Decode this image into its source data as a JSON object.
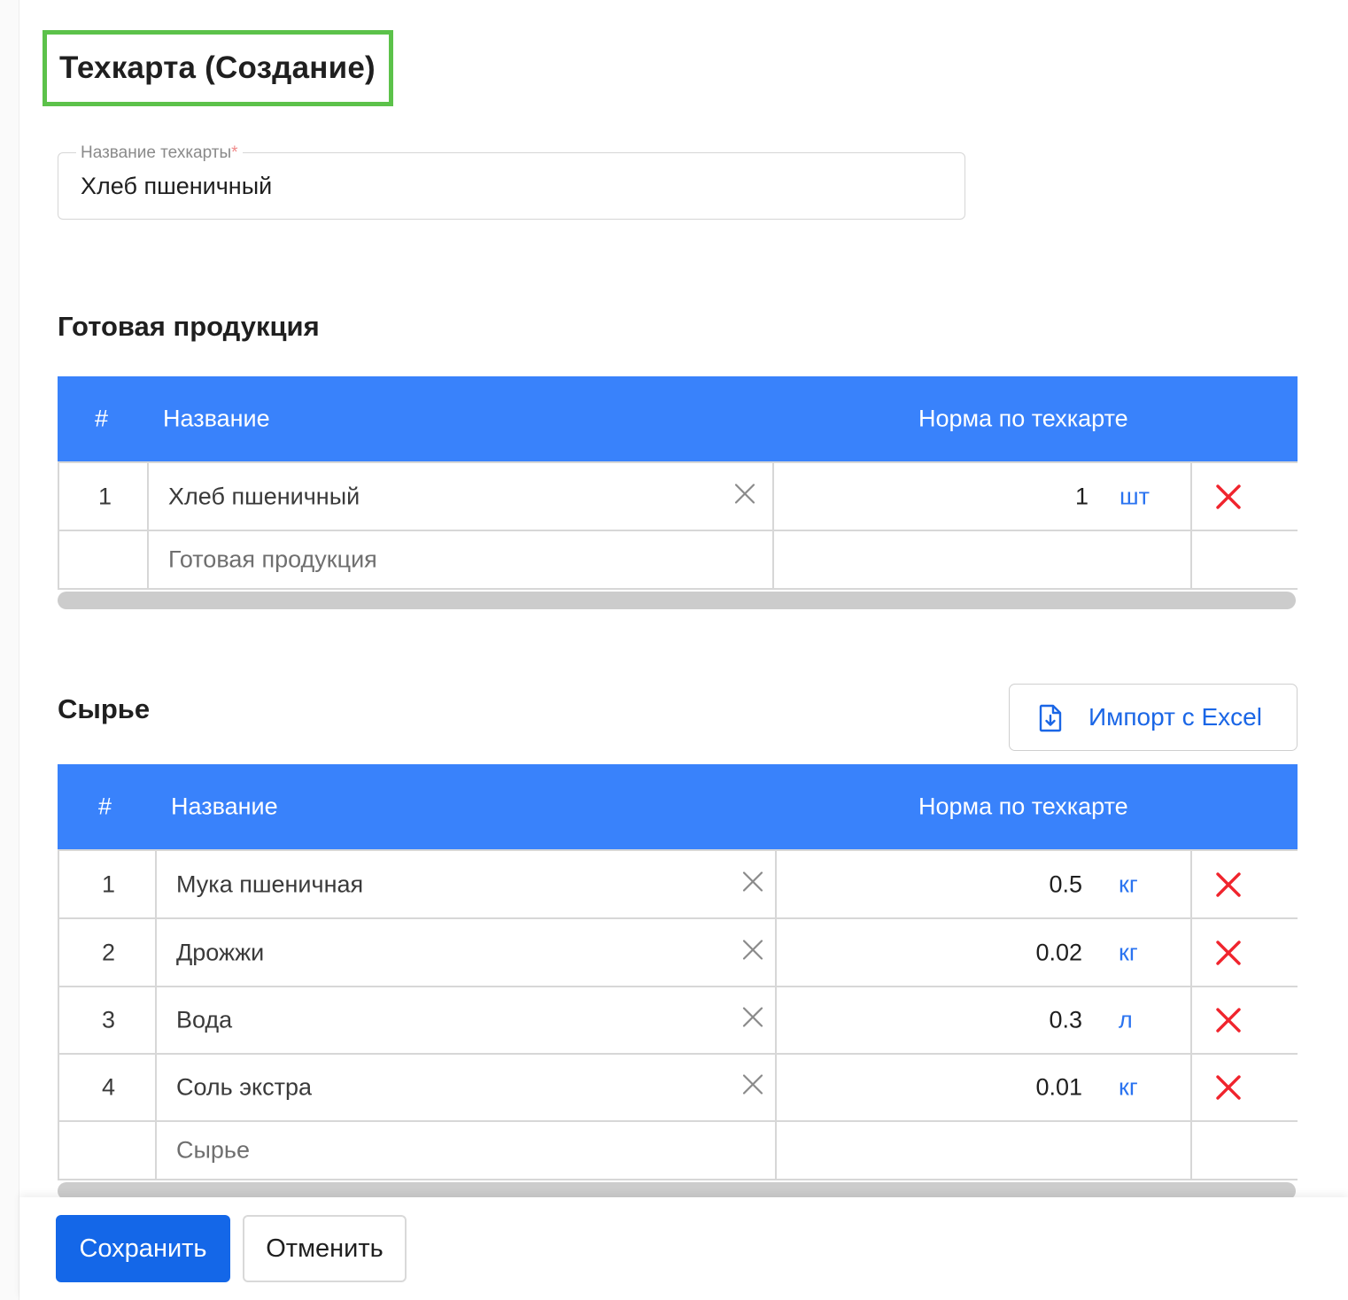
{
  "page": {
    "title": "Техкарта (Создание)"
  },
  "form": {
    "name_label": "Название техкарты",
    "required_mark": "*",
    "name_value": "Хлеб пшеничный"
  },
  "finished_products": {
    "title": "Готовая продукция",
    "columns": {
      "num": "#",
      "name": "Название",
      "norm": "Норма по техкарте"
    },
    "rows": [
      {
        "num": "1",
        "name": "Хлеб пшеничный",
        "qty": "1",
        "unit": "шт"
      }
    ],
    "add_placeholder": "Готовая продукция"
  },
  "raw_materials": {
    "title": "Сырье",
    "import_label": "Импорт с Excel",
    "columns": {
      "num": "#",
      "name": "Название",
      "norm": "Норма по техкарте"
    },
    "rows": [
      {
        "num": "1",
        "name": "Мука пшеничная",
        "qty": "0.5",
        "unit": "кг"
      },
      {
        "num": "2",
        "name": "Дрожжи",
        "qty": "0.02",
        "unit": "кг"
      },
      {
        "num": "3",
        "name": "Вода",
        "qty": "0.3",
        "unit": "л"
      },
      {
        "num": "4",
        "name": "Соль экстра",
        "qty": "0.01",
        "unit": "кг"
      }
    ],
    "add_placeholder": "Сырье"
  },
  "footer": {
    "save_label": "Сохранить",
    "cancel_label": "Отменить"
  },
  "colors": {
    "header_blue": "#3982fb",
    "primary_button": "#1467e8",
    "unit_link": "#2a73f0",
    "delete_red": "#f0242d",
    "title_highlight": "#5cc24a"
  },
  "icons": {
    "clear": "close-icon",
    "delete": "delete-icon",
    "import": "file-download-icon"
  }
}
